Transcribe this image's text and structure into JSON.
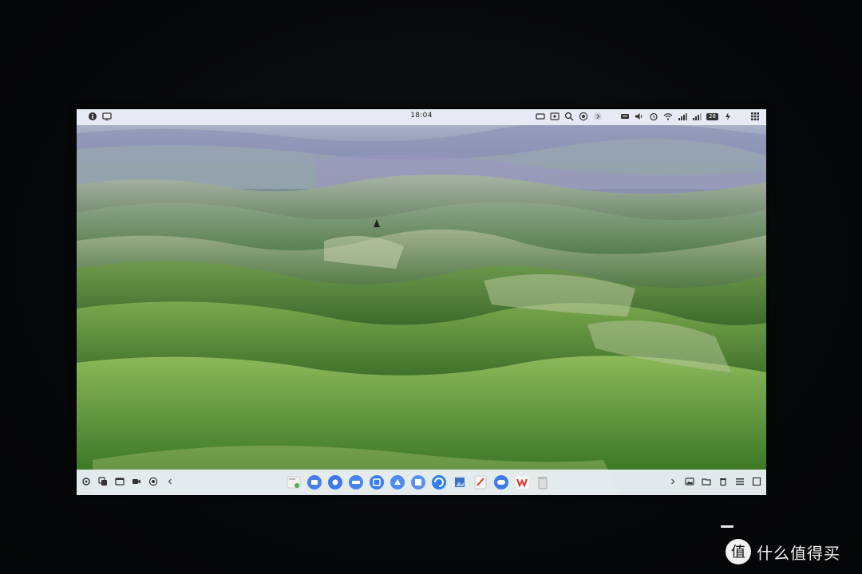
{
  "topbar": {
    "time": "18:04",
    "battery": "28",
    "left_icons": [
      "info-icon",
      "screen-share-icon"
    ],
    "right_icons": [
      "display-icon",
      "cast-icon",
      "search-icon",
      "record-icon",
      "chevron-icon",
      "keyboard-icon",
      "volume-icon",
      "alarm-icon",
      "wifi-icon",
      "signal-icon",
      "signal2-icon",
      "battery-icon",
      "grid-menu-icon"
    ]
  },
  "dock": {
    "left_icons": [
      "settings-icon",
      "multitask-icon",
      "window-icon",
      "camera-icon",
      "screen-record-icon",
      "collapse-left-icon"
    ],
    "apps": [
      {
        "name": "file-manager-app",
        "color": "#f4f4f4",
        "accent": "#4caf50"
      },
      {
        "name": "blue-app-1",
        "color": "#4a7de8"
      },
      {
        "name": "blue-app-2",
        "color": "#3d78f0"
      },
      {
        "name": "blue-app-3",
        "color": "#4a84ec"
      },
      {
        "name": "blue-app-4",
        "color": "#3c7ee9"
      },
      {
        "name": "blue-app-5",
        "color": "#4f8bf0"
      },
      {
        "name": "blue-app-6",
        "color": "#5a90f2"
      },
      {
        "name": "browser-app",
        "color": "#2f7ff4"
      },
      {
        "name": "image-viewer-app",
        "color": "#3b71c9"
      },
      {
        "name": "notes-app",
        "color": "#f5f5f5",
        "accent": "#d63a2f"
      },
      {
        "name": "chat-app",
        "color": "#3e7be6"
      },
      {
        "name": "wps-app",
        "color": "#ffffff",
        "accent": "#e53935"
      },
      {
        "name": "trash-app",
        "color": "#dcdcdc"
      }
    ],
    "right_icons": [
      "expand-right-icon",
      "photo-icon",
      "folder-icon",
      "trash-small-icon",
      "tasklist-icon",
      "show-desktop-icon"
    ]
  },
  "watermark": {
    "logo_char": "值",
    "text": "什么值得买"
  }
}
